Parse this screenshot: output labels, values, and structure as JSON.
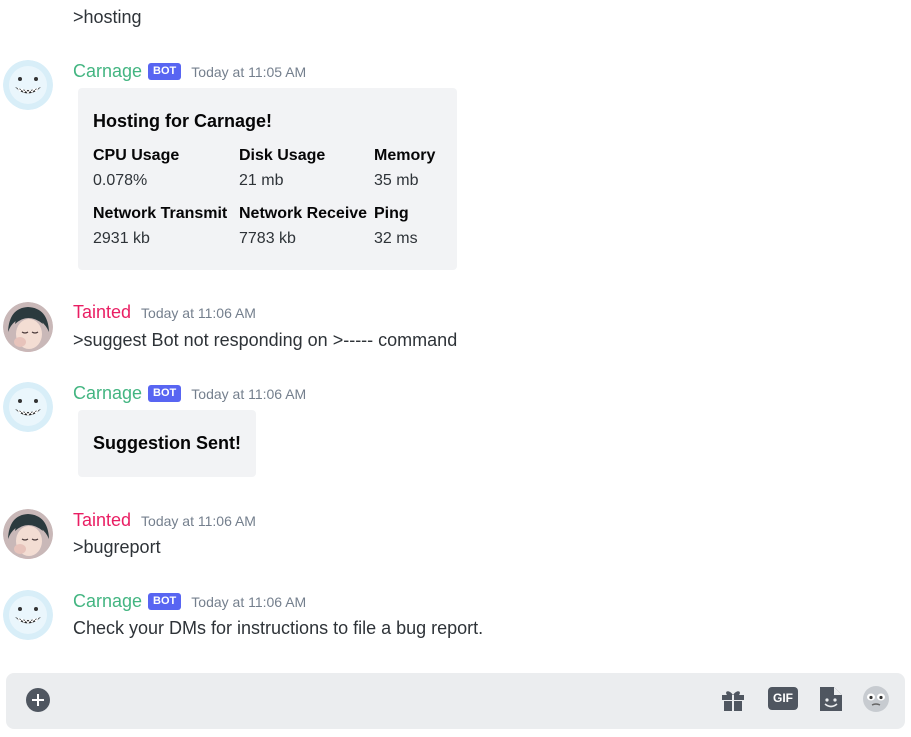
{
  "messages": [
    {
      "text": ">hosting"
    },
    {
      "author": "Carnage",
      "badge": "BOT",
      "time": "Today at 11:05 AM",
      "embed": {
        "title": "Hosting for Carnage!",
        "fields": [
          {
            "name": "CPU Usage",
            "value": "0.078%"
          },
          {
            "name": "Disk Usage",
            "value": "21 mb"
          },
          {
            "name": "Memory",
            "value": "35 mb"
          },
          {
            "name": "Network Transmit",
            "value": "2931 kb"
          },
          {
            "name": "Network Receive",
            "value": "7783 kb"
          },
          {
            "name": "Ping",
            "value": "32 ms"
          }
        ]
      }
    },
    {
      "author": "Tainted",
      "time": "Today at 11:06 AM",
      "text": ">suggest Bot not responding on >----- command"
    },
    {
      "author": "Carnage",
      "badge": "BOT",
      "time": "Today at 11:06 AM",
      "embed": {
        "title": "Suggestion Sent!"
      }
    },
    {
      "author": "Tainted",
      "time": "Today at 11:06 AM",
      "text": ">bugreport"
    },
    {
      "author": "Carnage",
      "badge": "BOT",
      "time": "Today at 11:06 AM",
      "text": "Check your DMs for instructions to file a bug report."
    }
  ],
  "input_bar": {
    "icons": [
      "add-icon",
      "gift-icon",
      "gif-icon",
      "sticker-icon",
      "emoji-icon"
    ],
    "gif_label": "GIF"
  },
  "colors": {
    "bot_name": "#43b581",
    "user_name": "#e91e63",
    "bot_badge": "#5865f2",
    "embed_bg": "#f2f3f5"
  }
}
